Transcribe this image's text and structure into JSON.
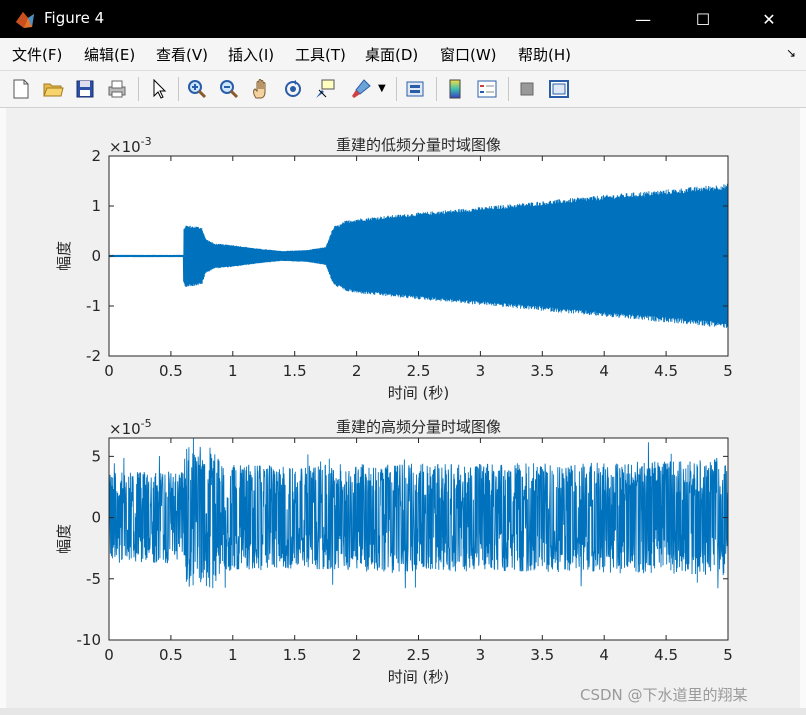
{
  "window": {
    "title": "Figure 4",
    "minimize_glyph": "—",
    "maximize_glyph": "☐",
    "close_glyph": "✕"
  },
  "menu": {
    "items": [
      "文件(F)",
      "编辑(E)",
      "查看(V)",
      "插入(I)",
      "工具(T)",
      "桌面(D)",
      "窗口(W)",
      "帮助(H)"
    ],
    "overflow_glyph": "↘"
  },
  "toolbar": {
    "icons": [
      "new-figure-icon",
      "open-file-icon",
      "save-icon",
      "print-icon",
      "pointer-icon",
      "zoom-in-icon",
      "zoom-out-icon",
      "pan-hand-icon",
      "rotate-3d-icon",
      "data-cursor-icon",
      "brush-icon",
      "link-plot-icon",
      "colorbar-icon",
      "legend-icon",
      "hide-plot-tools-icon",
      "show-plot-tools-icon"
    ]
  },
  "colors": {
    "signal": "#0072BD",
    "axes_text": "#262626"
  },
  "chart_data": [
    {
      "type": "line",
      "title": "重建的低频分量时域图像",
      "xlabel": "时间 (秒)",
      "ylabel": "幅度",
      "exponent_label": "×10",
      "exponent": "-3",
      "xlim": [
        0,
        5
      ],
      "ylim": [
        -2,
        2
      ],
      "xticks": [
        "0",
        "0.5",
        "1",
        "1.5",
        "2",
        "2.5",
        "3",
        "3.5",
        "4",
        "4.5",
        "5"
      ],
      "yticks": [
        "2",
        "1",
        "0",
        "-1",
        "-2"
      ],
      "envelope": {
        "t": [
          0,
          0.6,
          0.6,
          0.62,
          0.75,
          0.78,
          0.85,
          1.0,
          1.2,
          1.4,
          1.6,
          1.75,
          1.8,
          1.82,
          1.88,
          1.9,
          2.0,
          2.5,
          3.0,
          3.5,
          4.0,
          4.5,
          5.0
        ],
        "amp": [
          0.02,
          0.02,
          0.55,
          0.62,
          0.58,
          0.35,
          0.25,
          0.22,
          0.15,
          0.1,
          0.12,
          0.18,
          0.5,
          0.6,
          0.65,
          0.7,
          0.75,
          0.87,
          0.98,
          1.1,
          1.22,
          1.33,
          1.45
        ]
      }
    },
    {
      "type": "line",
      "title": "重建的高频分量时域图像",
      "xlabel": "时间 (秒)",
      "ylabel": "幅度",
      "exponent_label": "×10",
      "exponent": "-5",
      "xlim": [
        0,
        5
      ],
      "ylim": [
        -10,
        6.5
      ],
      "xticks": [
        "0",
        "0.5",
        "1",
        "1.5",
        "2",
        "2.5",
        "3",
        "3.5",
        "4",
        "4.5",
        "5"
      ],
      "yticks": [
        "5",
        "0",
        "-5",
        "-10"
      ],
      "envelope": {
        "t": [
          0,
          0.6,
          0.62,
          0.85,
          0.9,
          1.5,
          2.0,
          3.0,
          4.0,
          5.0
        ],
        "amp": [
          3.5,
          3.6,
          5.5,
          5.5,
          4.2,
          4.0,
          4.2,
          4.2,
          4.3,
          4.5
        ]
      }
    }
  ],
  "watermark": "CSDN @下水道里的翔某"
}
